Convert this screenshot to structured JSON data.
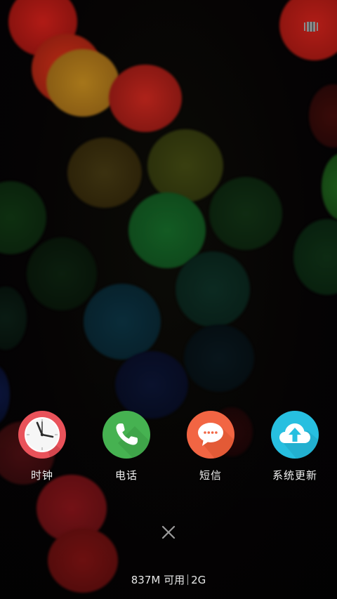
{
  "recents": {
    "apps": [
      {
        "label": "时钟",
        "icon": "clock-icon",
        "color": "#E9525A"
      },
      {
        "label": "电话",
        "icon": "phone-icon",
        "color": "#46B251"
      },
      {
        "label": "短信",
        "icon": "message-icon",
        "color": "#F26543"
      },
      {
        "label": "系统更新",
        "icon": "cloud-upload-icon",
        "color": "#27BFE0"
      }
    ],
    "multiwindow_icon": "multiwindow-icon",
    "close_icon": "close-icon"
  },
  "status": {
    "memory_available": "837M 可用",
    "memory_total": "2G"
  }
}
